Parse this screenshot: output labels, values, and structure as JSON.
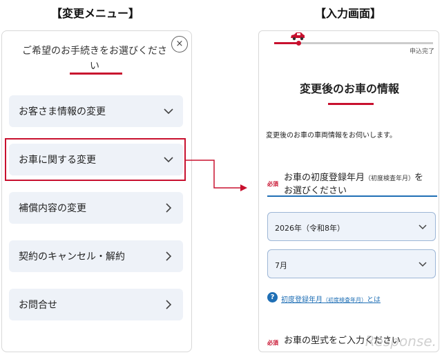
{
  "left_heading": "【変更メニュー】",
  "right_heading": "【入力画面】",
  "menu": {
    "title": "ご希望のお手続きをお選びください",
    "close_glyph": "×",
    "items": [
      {
        "label": "お客さま情報の変更",
        "icon": "chevron-down-icon"
      },
      {
        "label": "お車に関する変更",
        "icon": "chevron-down-icon"
      },
      {
        "label": "補償内容の変更",
        "icon": "chevron-right-icon"
      },
      {
        "label": "契約のキャンセル・解約",
        "icon": "chevron-right-icon"
      },
      {
        "label": "お問合せ",
        "icon": "chevron-right-icon"
      }
    ]
  },
  "form": {
    "progress_end_label": "申込完了",
    "progress_fraction": 0.15,
    "title": "変更後のお車の情報",
    "description": "変更後のお車の車両情報をお伺いします。",
    "required_badge": "必須",
    "question1_main": "お車の初度登録年月",
    "question1_note": "（初度検査年月）",
    "question1_tail": "を",
    "question1_line2": "お選びください",
    "year_select_value": "2026年（令和8年）",
    "month_select_value": "7月",
    "help_glyph": "?",
    "help_link_main": "初度登録年月",
    "help_link_note": "（初度検査年月）",
    "help_link_tail": "とは",
    "question2": "お車の型式をご入力ください"
  },
  "watermark": "Response.",
  "colors": {
    "accent": "#c8102e",
    "link": "#1f6fb5",
    "menu_bg": "#eef2f8"
  }
}
